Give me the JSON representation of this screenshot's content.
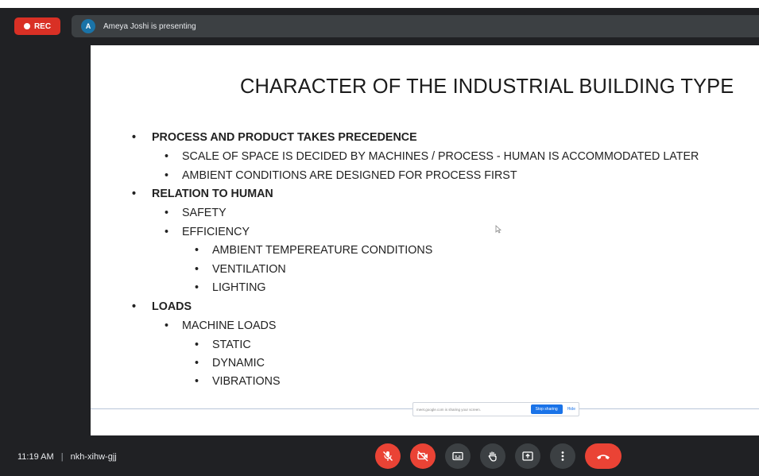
{
  "recording": {
    "label": "REC",
    "color": "#d93025"
  },
  "presenter": {
    "avatar_initial": "A",
    "text": "Ameya Joshi is presenting"
  },
  "slide": {
    "title": "CHARACTER OF THE INDUSTRIAL BUILDING TYPE",
    "bullets": [
      "PROCESS AND PRODUCT TAKES PRECEDENCE",
      "SCALE OF SPACE IS DECIDED BY MACHINES / PROCESS - HUMAN IS ACCOMMODATED LATER",
      "AMBIENT CONDITIONS ARE DESIGNED FOR PROCESS FIRST",
      "RELATION TO HUMAN",
      "SAFETY",
      "EFFICIENCY",
      "AMBIENT TEMPEREATURE CONDITIONS",
      "VENTILATION",
      "LIGHTING",
      "LOADS",
      "MACHINE LOADS",
      "STATIC",
      "DYNAMIC",
      "VIBRATIONS"
    ]
  },
  "share_notice": {
    "text": "meet.google.com is sharing your screen.",
    "stop_label": "Stop sharing",
    "hide_label": "Hide"
  },
  "footer": {
    "time": "11:19 AM",
    "separator": "|",
    "meeting_code": "nkh-xihw-gjj"
  },
  "controls": [
    {
      "icon": "mic-off-icon",
      "state": "off"
    },
    {
      "icon": "camera-off-icon",
      "state": "off"
    },
    {
      "icon": "captions-icon"
    },
    {
      "icon": "raise-hand-icon"
    },
    {
      "icon": "present-screen-icon"
    },
    {
      "icon": "more-options-icon"
    },
    {
      "icon": "end-call-icon"
    }
  ],
  "colors": {
    "accent_red": "#ea4335",
    "control_bg": "#3c4043",
    "background": "#202124",
    "link_blue": "#1a73e8"
  }
}
